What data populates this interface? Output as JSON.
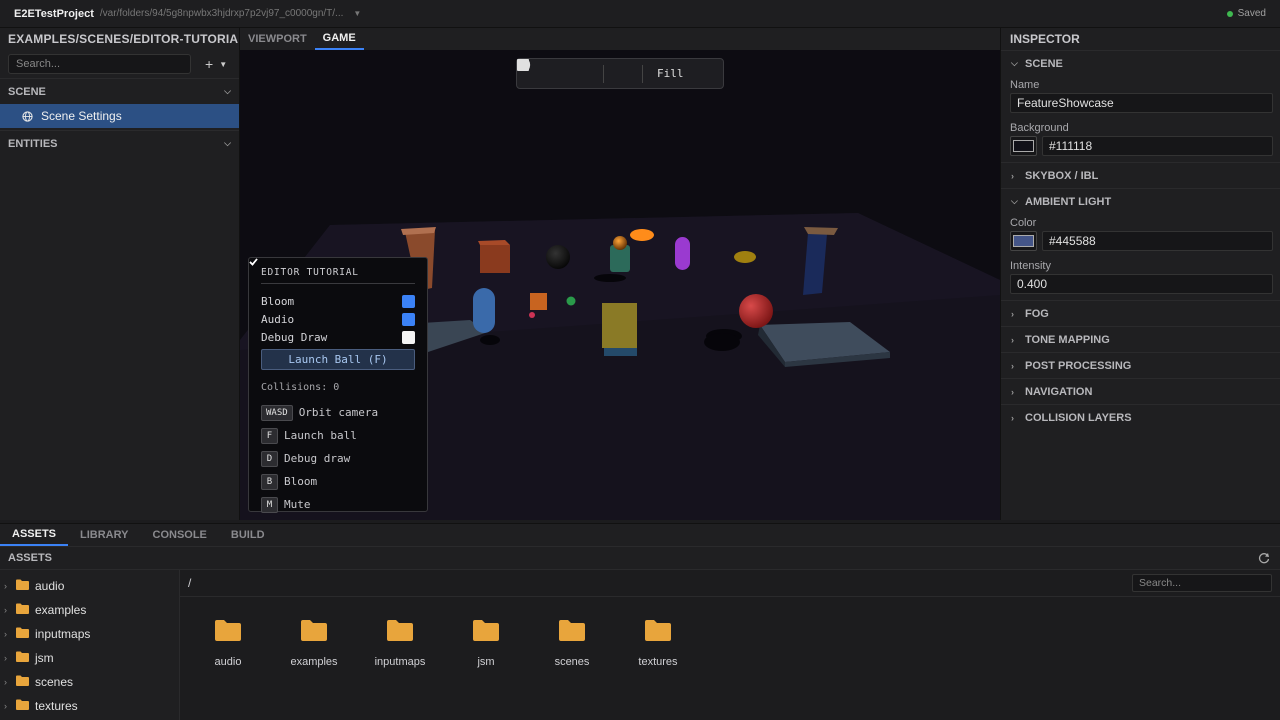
{
  "titlebar": {
    "app_name": "E2ETestProject",
    "path": "/var/folders/94/5g8npwbx3hjdrxp7p2vj97_c0000gn/T/...",
    "saved": "Saved",
    "saved_color": "#3fb950"
  },
  "left_panel": {
    "title": "EXAMPLES/SCENES/EDITOR-TUTORIAL.VS",
    "search_placeholder": "Search...",
    "add_icon": "plus-icon",
    "scene_section": "SCENE",
    "scene_item": "Scene Settings",
    "scene_item_icon": "globe-icon",
    "entities_section": "ENTITIES"
  },
  "view_tabs": [
    "VIEWPORT",
    "GAME"
  ],
  "view_tabs_active": "GAME",
  "playbar": {
    "pause_icon": "pause-icon",
    "stop_icon": "stop-icon",
    "volume_icon": "volume-icon",
    "monitor_icon": "monitor-icon",
    "fill_label": "Fill"
  },
  "tutorial": {
    "title": "EDITOR TUTORIAL",
    "toggles": [
      {
        "label": "Bloom",
        "checked": true
      },
      {
        "label": "Audio",
        "checked": true
      },
      {
        "label": "Debug Draw",
        "checked": false
      }
    ],
    "launch_button": "Launch Ball (F)",
    "collisions": "Collisions: 0",
    "keys": [
      {
        "key": "WASD",
        "action": "Orbit camera"
      },
      {
        "key": "F",
        "action": "Launch ball"
      },
      {
        "key": "D",
        "action": "Debug draw"
      },
      {
        "key": "B",
        "action": "Bloom"
      },
      {
        "key": "M",
        "action": "Mute"
      }
    ]
  },
  "inspector": {
    "title": "INSPECTOR",
    "scene": {
      "label": "SCENE",
      "name_label": "Name",
      "name_value": "FeatureShowcase",
      "background_label": "Background",
      "background_value": "#111118",
      "background_color": "#111118"
    },
    "skybox": "SKYBOX / IBL",
    "ambient": {
      "label": "AMBIENT LIGHT",
      "color_label": "Color",
      "color_value": "#445588",
      "color": "#445588",
      "intensity_label": "Intensity",
      "intensity_value": "0.400"
    },
    "collapsed_sections": [
      "FOG",
      "TONE MAPPING",
      "POST PROCESSING",
      "NAVIGATION",
      "COLLISION LAYERS"
    ]
  },
  "bottom_tabs": [
    "ASSETS",
    "LIBRARY",
    "CONSOLE",
    "BUILD"
  ],
  "bottom_tabs_active": "ASSETS",
  "assets": {
    "header": "ASSETS",
    "refresh_icon": "refresh-icon",
    "path": "/",
    "search_placeholder": "Search...",
    "tree": [
      "audio",
      "examples",
      "inputmaps",
      "jsm",
      "scenes",
      "textures"
    ],
    "tiles": [
      "audio",
      "examples",
      "inputmaps",
      "jsm",
      "scenes",
      "textures"
    ],
    "folder_color": "#e8a53c"
  },
  "accent_color": "#3b82f6"
}
